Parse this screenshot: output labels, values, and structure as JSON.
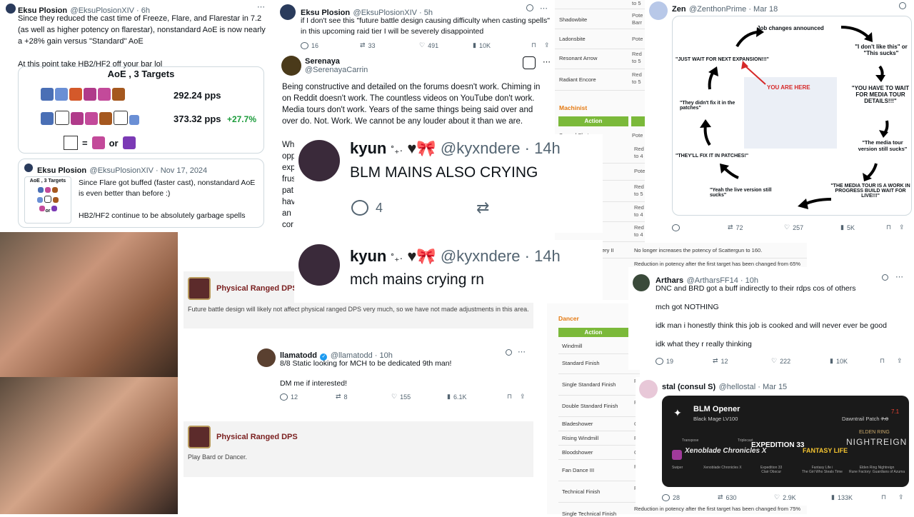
{
  "tweet1": {
    "name": "Eksu Plosion",
    "handle": "@EksuPlosionXIV · 6h",
    "text": "Since they reduced the cast time of Freeze, Flare, and Flarestar in 7.2 (as well as higher potency on flarestar), nonstandard AoE is now nearly a +28% gain versus \"Standard\" AoE\n\nAt this point take HB2/HF2 off your bar lol",
    "card_title": "AoE , 3 Targets",
    "pps1": "292.24 pps",
    "pps2": "373.32 pps",
    "gain": "+27.7%",
    "legend_eq": "=",
    "legend_or": "or"
  },
  "quote1": {
    "name": "Eksu Plosion",
    "handle": "@EksuPlosionXIV · Nov 17, 2024",
    "thumb_title": "AoE , 3 Targets",
    "thumb_or": "or",
    "text": "Since Flare got buffed (faster cast), nonstandard AoE is even better than before :)\n\nHB2/HF2 continue to be absolutely garbage spells"
  },
  "tweet2": {
    "name": "Eksu Plosion",
    "handle": "@EksuPlosionXIV · 5h",
    "text": "if I don't see this \"future battle design causing difficulty when casting spells\" in this upcoming raid tier I will be severely disappointed",
    "replies": "16",
    "retweets": "33",
    "likes": "491",
    "views": "10K"
  },
  "tweet3": {
    "name": "Serenaya",
    "handle": "@SerenayaCarrin",
    "text": "Being constructive and detailed on the forums doesn't work. Chiming in on Reddit doesn't work. The countless videos on YouTube don't work. Media tours don't work. Years of the same things being said over and over do. Not. Work. We cannot be any louder about it than we are.",
    "partial_lines": [
      "Wh",
      "opp",
      "exp",
      "frus",
      "pat",
      "hav",
      "an",
      "cor"
    ]
  },
  "kyun1": {
    "name": "kyun",
    "deco": "˚₊·",
    "handle": "@kyxndere · 14h",
    "text": "BLM MAINS ALSO CRYING",
    "replies": "4"
  },
  "kyun2": {
    "name": "kyun",
    "deco": "˚₊·",
    "handle": "@kyxndere · 14h",
    "text": "mch mains crying rn"
  },
  "table_top": {
    "rows": [
      {
        "action": "",
        "eff": "to 5"
      },
      {
        "action": "Shadowbite",
        "eff": "Pote\nBarr"
      },
      {
        "action": "Ladonsbite",
        "eff": "Pote"
      },
      {
        "action": "Resonant Arrow",
        "eff": "Red\nto 5"
      },
      {
        "action": "Radiant Encore",
        "eff": "Red\nto 5"
      }
    ],
    "machinist_label": "Machinist",
    "action_label": "Action",
    "mch_rows": [
      {
        "action": "Spread Shot",
        "eff": "Pote"
      },
      {
        "action": "",
        "eff": "Red\nto 4"
      },
      {
        "action": "",
        "eff": "Pote"
      },
      {
        "action": "",
        "eff": "Red\nto 5"
      },
      {
        "action": "",
        "eff": "Red\nto 4"
      },
      {
        "action": "",
        "eff": "Red\nto 4"
      }
    ],
    "scattergun_action": "ery II",
    "scattergun_eff": "No longer increases the potency of Scattergun to 160.",
    "reduction_text": "Reduction in potency after the first target has been changed from 65%"
  },
  "zen": {
    "name": "Zen",
    "handle": "@ZenthonPrime · Mar 18",
    "cycle": {
      "announced": "Job changes announced",
      "dont_like": "\"I don't like this\" or \"This sucks\"",
      "media_tour": "\"YOU HAVE TO WAIT FOR MEDIA TOUR DETAILS!!!\"",
      "tour_version": "\"The media tour version still sucks\"",
      "work_in_progress": "\"THE MEDIA TOUR IS A WORK IN PROGRESS BUILD WAIT FOR LIVE!!!\"",
      "live_sucks": "\"Yeah the live version still sucks\"",
      "fix_patches": "\"THEY'LL FIX IT IN PATCHES!\"",
      "didnt_fix": "\"They didn't fix it in the patches\"",
      "next_expansion": "\"JUST WAIT FOR NEXT EXPANSION!!!\"",
      "you_are_here": "YOU ARE HERE"
    },
    "replies": "",
    "retweets": "72",
    "likes": "257",
    "views": "5K"
  },
  "dps1": {
    "title": "Physical Ranged DPS",
    "text": "Future battle design will likely not affect physical ranged DPS very much, so we have not made adjustments in this area."
  },
  "llama": {
    "name": "llamatodd",
    "handle": "@llamatodd · 10h",
    "text": "8/8 Static looking for MCH to be dedicated 9th man!\n\nDM me if interested!",
    "replies": "12",
    "retweets": "8",
    "likes": "155",
    "views": "6.1K"
  },
  "dps2": {
    "title": "Physical Ranged DPS",
    "text": "Play Bard or Dancer."
  },
  "dancer_table": {
    "label": "Dancer",
    "action_label": "Action",
    "rows": [
      {
        "action": "Windmill",
        "eff": ""
      },
      {
        "action": "Standard Finish",
        "eff": "R"
      },
      {
        "action": "Single Standard Finish",
        "eff": "R"
      },
      {
        "action": "Double Standard Finish",
        "eff": "R"
      },
      {
        "action": "Bladeshower",
        "eff": "C"
      },
      {
        "action": "Rising Windmill",
        "eff": "R"
      },
      {
        "action": "Bloodshower",
        "eff": "C"
      },
      {
        "action": "Fan Dance III",
        "eff": "R"
      },
      {
        "action": "Technical Finish",
        "eff": "R"
      },
      {
        "action": "Single Technical Finish",
        "eff": "R"
      }
    ],
    "reduction_text": "Reduction in potency after the first target has been changed from 75%"
  },
  "arthars": {
    "name": "Arthars",
    "handle": "@ArtharsFF14 · 10h",
    "lines": [
      "DNC and BRD got a buff indirectly to their rdps cos of others",
      "mch got NOTHING",
      "idk man i honestly think this job is cooked and will never ever be good",
      "idk what they r really thinking"
    ],
    "replies": "19",
    "retweets": "12",
    "likes": "222",
    "views": "10K"
  },
  "stal": {
    "name": "stal (consul S)",
    "handle": "@hellostal · Mar 15",
    "card_title": "BLM Opener",
    "card_sub": "Black Mage LV100",
    "patch": "Dawntrail Patch",
    "patch_num": "7.0",
    "patch_num2": "7.1",
    "games": [
      "Xenoblade Chronicles X",
      "EXPEDITION 33",
      "FANTASY LIFE",
      "NIGHTREIGN"
    ],
    "game_captions": [
      "Swiper",
      "Xenoblade Chronicles X",
      "Expedition 33\nClair Obscur",
      "Fantasy Life i\nThe Girl Who Steals Time",
      "Elden Ring Nightreign\nRune Factory: Guardians of Azuma"
    ],
    "ring_top": "ELDEN RING",
    "tags": [
      "Transpose",
      "Triplecast"
    ],
    "replies": "28",
    "retweets": "630",
    "likes": "2.9K",
    "views": "133K"
  },
  "colors": {
    "accent": "#1d9bf0",
    "green": "#00ba7c",
    "table_green": "#7bb93a",
    "orange": "#e47911",
    "dps_title": "#7a1f1f"
  }
}
